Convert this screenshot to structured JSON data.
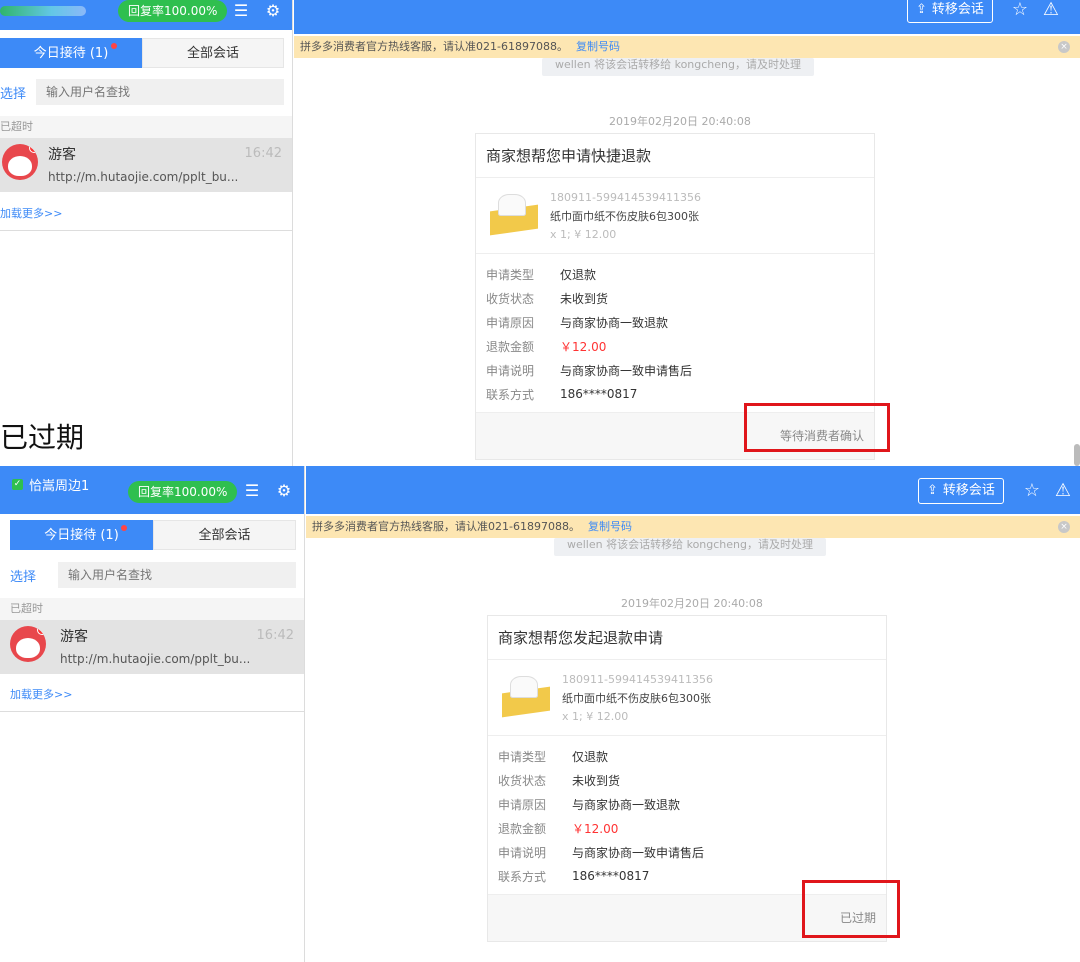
{
  "colors": {
    "brand": "#3d8af7",
    "rate_green": "#2fbf4f",
    "notice_bg": "#fde6b2",
    "highlight": "#e0161b",
    "price_red": "#ff3333"
  },
  "caption": "已过期",
  "panel1": {
    "rate": "回复率100.00%",
    "tabs": {
      "today": "今日接待 (1)",
      "all": "全部会话"
    },
    "select_link": "选择",
    "search_placeholder": "输入用户名查找",
    "section": "已超时",
    "conversation": {
      "name": "游客",
      "time": "16:42",
      "url": "http://m.hutaojie.com/pplt_bu..."
    },
    "load_more": "加载更多>>",
    "transfer": "转移会话",
    "notice": {
      "text": "拼多多消费者官方热线客服，请认准021-61897088。",
      "copy": "复制号码"
    },
    "system_message": "wellen 将该会话转移给 kongcheng，请及时处理",
    "timestamp": "2019年02月20日 20:40:08",
    "card": {
      "title": "商家想帮您申请快捷退款",
      "product_id": "180911-599414539411356",
      "product_name": "纸巾面巾纸不伤皮肤6包300张",
      "qty_price": "x 1;  ¥ 12.00",
      "rows": [
        {
          "label": "申请类型",
          "value": "仅退款"
        },
        {
          "label": "收货状态",
          "value": "未收到货"
        },
        {
          "label": "申请原因",
          "value": "与商家协商一致退款"
        },
        {
          "label": "退款金额",
          "value": "￥12.00"
        },
        {
          "label": "申请说明",
          "value": "与商家协商一致申请售后"
        },
        {
          "label": "联系方式",
          "value": "186****0817"
        }
      ],
      "status": "等待消费者确认"
    }
  },
  "panel2": {
    "shop_name": "恰嵩周边1",
    "rate": "回复率100.00%",
    "tabs": {
      "today": "今日接待 (1)",
      "all": "全部会话"
    },
    "select_link": "选择",
    "search_placeholder": "输入用户名查找",
    "section": "已超时",
    "conversation": {
      "name": "游客",
      "time": "16:42",
      "url": "http://m.hutaojie.com/pplt_bu..."
    },
    "load_more": "加载更多>>",
    "transfer": "转移会话",
    "notice": {
      "text": "拼多多消费者官方热线客服，请认准021-61897088。",
      "copy": "复制号码"
    },
    "system_message": "wellen 将该会话转移给 kongcheng，请及时处理",
    "timestamp": "2019年02月20日 20:40:08",
    "card": {
      "title": "商家想帮您发起退款申请",
      "product_id": "180911-599414539411356",
      "product_name": "纸巾面巾纸不伤皮肤6包300张",
      "qty_price": "x 1;  ¥ 12.00",
      "rows": [
        {
          "label": "申请类型",
          "value": "仅退款"
        },
        {
          "label": "收货状态",
          "value": "未收到货"
        },
        {
          "label": "申请原因",
          "value": "与商家协商一致退款"
        },
        {
          "label": "退款金额",
          "value": "￥12.00"
        },
        {
          "label": "申请说明",
          "value": "与商家协商一致申请售后"
        },
        {
          "label": "联系方式",
          "value": "186****0817"
        }
      ],
      "status": "已过期"
    }
  }
}
